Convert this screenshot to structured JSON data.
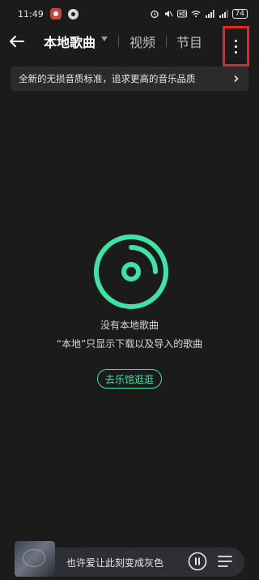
{
  "status_bar": {
    "time": "11:49",
    "battery": "74"
  },
  "nav": {
    "tabs": [
      {
        "label": "本地歌曲",
        "active": true
      },
      {
        "label": "视频",
        "active": false
      },
      {
        "label": "节目",
        "active": false
      }
    ],
    "icons": {
      "back": "back-arrow-icon",
      "more": "more-vertical-icon"
    }
  },
  "banner": {
    "text": "全新的无损音质标准，追求更高的音乐品质"
  },
  "empty_state": {
    "title": "没有本地歌曲",
    "description": "“本地”只显示下载以及导入的歌曲",
    "action_label": "去乐馆逛逛"
  },
  "player": {
    "song_title": "也许爱让此刻变成灰色"
  },
  "colors": {
    "accent": "#3ee3a5",
    "background": "#1b1b1b",
    "highlight_box": "#e3262a"
  }
}
